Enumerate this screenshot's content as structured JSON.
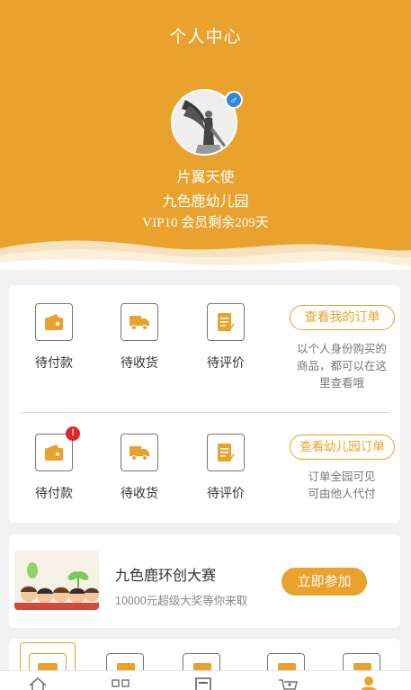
{
  "header": {
    "title": "个人中心",
    "username": "片翼天使",
    "school": "九色鹿幼儿园",
    "vip_text": "VIP10 会员剩余209天",
    "gender_symbol": "♂"
  },
  "my_orders": {
    "items": [
      {
        "label": "待付款",
        "icon": "wallet-icon"
      },
      {
        "label": "待收货",
        "icon": "truck-icon"
      },
      {
        "label": "待评价",
        "icon": "review-icon"
      }
    ],
    "button": "查看我的订单",
    "hint_lines": [
      "以个人身份购买的",
      "商品，都可以在这",
      "里查看哦"
    ]
  },
  "school_orders": {
    "items": [
      {
        "label": "待付款",
        "icon": "wallet-icon",
        "badge": "!"
      },
      {
        "label": "待收货",
        "icon": "truck-icon"
      },
      {
        "label": "待评价",
        "icon": "review-icon"
      }
    ],
    "button": "查看幼儿园订单",
    "hint_lines": [
      "订单全园可见",
      "可由他人代付"
    ]
  },
  "promo": {
    "title": "九色鹿环创大赛",
    "subtitle": "10000元超级大奖等你来取",
    "button": "立即参加"
  },
  "colors": {
    "accent": "#e9a22d",
    "badge": "#e4242b",
    "gender": "#2f8bd9"
  }
}
